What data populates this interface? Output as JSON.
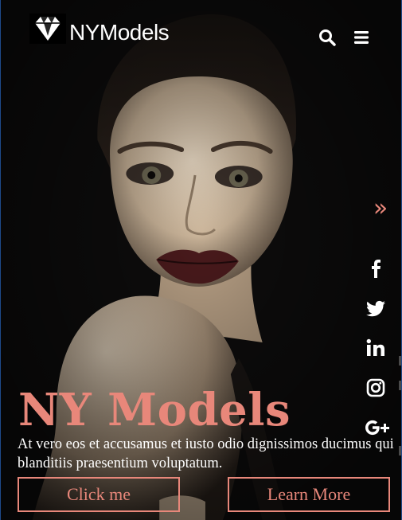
{
  "brand": {
    "name": "NYModels",
    "logo": "diamond-logo"
  },
  "header": {
    "icons": [
      "search-icon",
      "hamburger-menu-icon"
    ]
  },
  "side_rail": {
    "toggle_icon": "double-chevron-right-icon",
    "social_icons": [
      "facebook-icon",
      "twitter-icon",
      "linkedin-icon",
      "instagram-icon",
      "google-plus-icon"
    ]
  },
  "hero": {
    "title": "NY Models",
    "paragraph": "At vero eos et accusamus et iusto odio dignissimos ducimus qui blanditiis praesentium voluptatum.",
    "buttons": {
      "primary": "Click me",
      "secondary": "Learn More"
    }
  },
  "colors": {
    "accent": "#e8877a",
    "text": "#ffffff",
    "background": "#0b0a0a"
  }
}
